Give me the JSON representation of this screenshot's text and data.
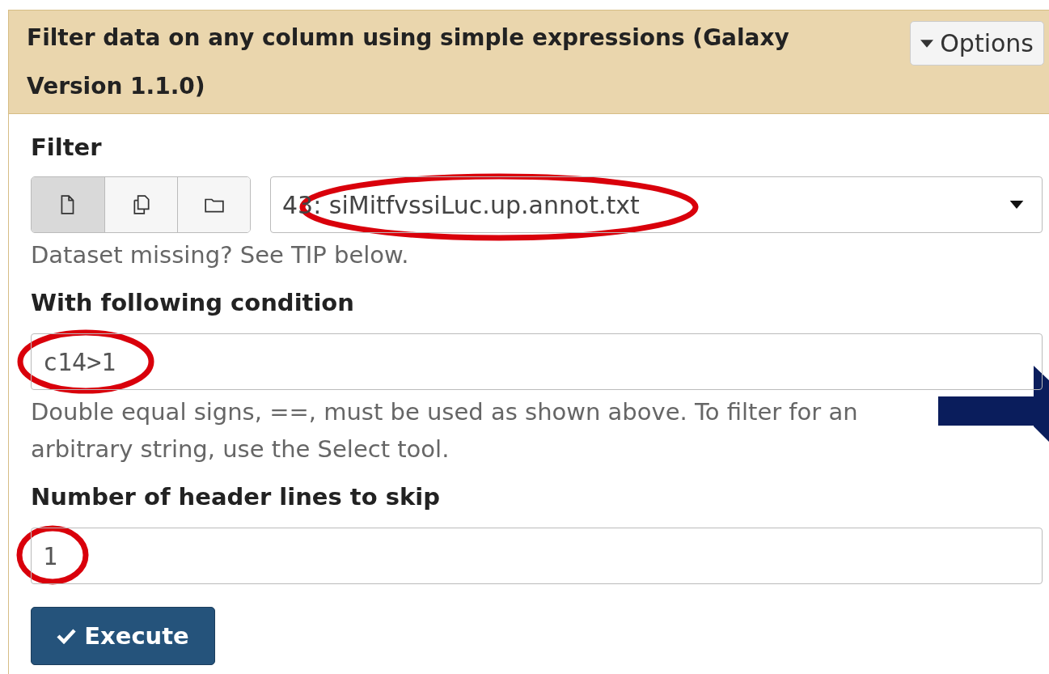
{
  "tool": {
    "title": "Filter data on any column using simple expressions (Galaxy Version 1.1.0)",
    "options_button": "Options"
  },
  "fields": [
    {
      "kind": "dataset",
      "label": "Filter",
      "sources": [
        {
          "kind": "single",
          "selected": true
        },
        {
          "kind": "multiple",
          "selected": false
        },
        {
          "kind": "collection",
          "selected": false
        }
      ],
      "value": "43: siMitfvssiLuc.up.annot.txt",
      "help": "Dataset missing? See TIP below."
    },
    {
      "kind": "text",
      "label": "With following condition",
      "value": "c14>1",
      "help": "Double equal signs, ==, must be used as shown above. To filter for an arbitrary string, use the Select tool."
    },
    {
      "kind": "text",
      "label": "Number of header lines to skip",
      "value": "1"
    }
  ],
  "execute_button": "Execute"
}
